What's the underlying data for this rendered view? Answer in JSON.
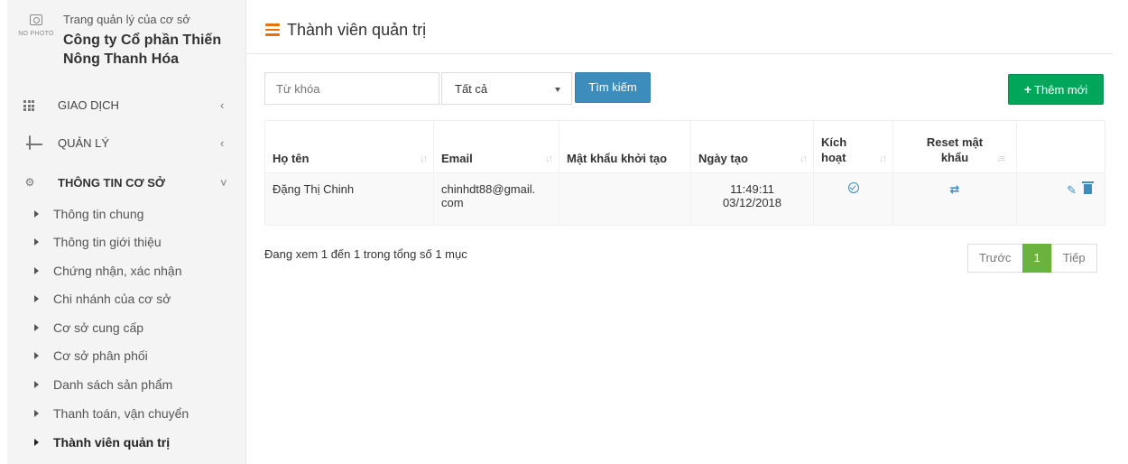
{
  "sidebar": {
    "no_photo": "NO PHOTO",
    "org_subtitle": "Trang quản lý của cơ sở",
    "org_name": "Công ty Cổ phần Thiến Nông Thanh Hóa",
    "menu": [
      {
        "label": "GIAO DỊCH",
        "icon": "grid-icon",
        "chevron": "‹"
      },
      {
        "label": "QUẢN LÝ",
        "icon": "laptop-icon",
        "chevron": "‹"
      },
      {
        "label": "THÔNG TIN CƠ SỞ",
        "icon": "cogs-icon",
        "chevron": "˅"
      }
    ],
    "sub_items": [
      "Thông tin chung",
      "Thông tin giới thiệu",
      "Chứng nhận, xác nhận",
      "Chi nhánh của cơ sở",
      "Cơ sở cung cấp",
      "Cơ sở phân phối",
      "Danh sách sản phẩm",
      "Thanh toán, vận chuyển",
      "Thành viên quản trị"
    ],
    "active_sub_item": "Thành viên quản trị"
  },
  "header": {
    "title": "Thành viên quản trị"
  },
  "filters": {
    "keyword_placeholder": "Từ khóa",
    "status_selected": "Tất cả",
    "search_label": "Tìm kiếm",
    "add_label": "Thêm mới"
  },
  "table": {
    "headers": {
      "name": "Họ tên",
      "email": "Email",
      "initial_password": "Mật khẩu khởi tạo",
      "created": "Ngày tạo",
      "active_line1": "Kích",
      "active_line2": "hoạt",
      "reset_line1": "Reset mật",
      "reset_line2": "khẩu"
    },
    "rows": [
      {
        "name": "Đặng Thị Chinh",
        "email_line1": "chinhdt88@gmail.",
        "email_line2": "com",
        "initial_password": "",
        "created_time": "11:49:11",
        "created_date": "03/12/2018"
      }
    ]
  },
  "footer": {
    "info": "Đang xem 1 đến 1 trong tổng số 1 mục",
    "prev": "Trước",
    "current_page": "1",
    "next": "Tiếp"
  },
  "colors": {
    "accent_orange": "#e8710a",
    "primary_blue": "#3c8dbc",
    "success_green": "#00a65a",
    "active_page_green": "#6cb23f"
  }
}
